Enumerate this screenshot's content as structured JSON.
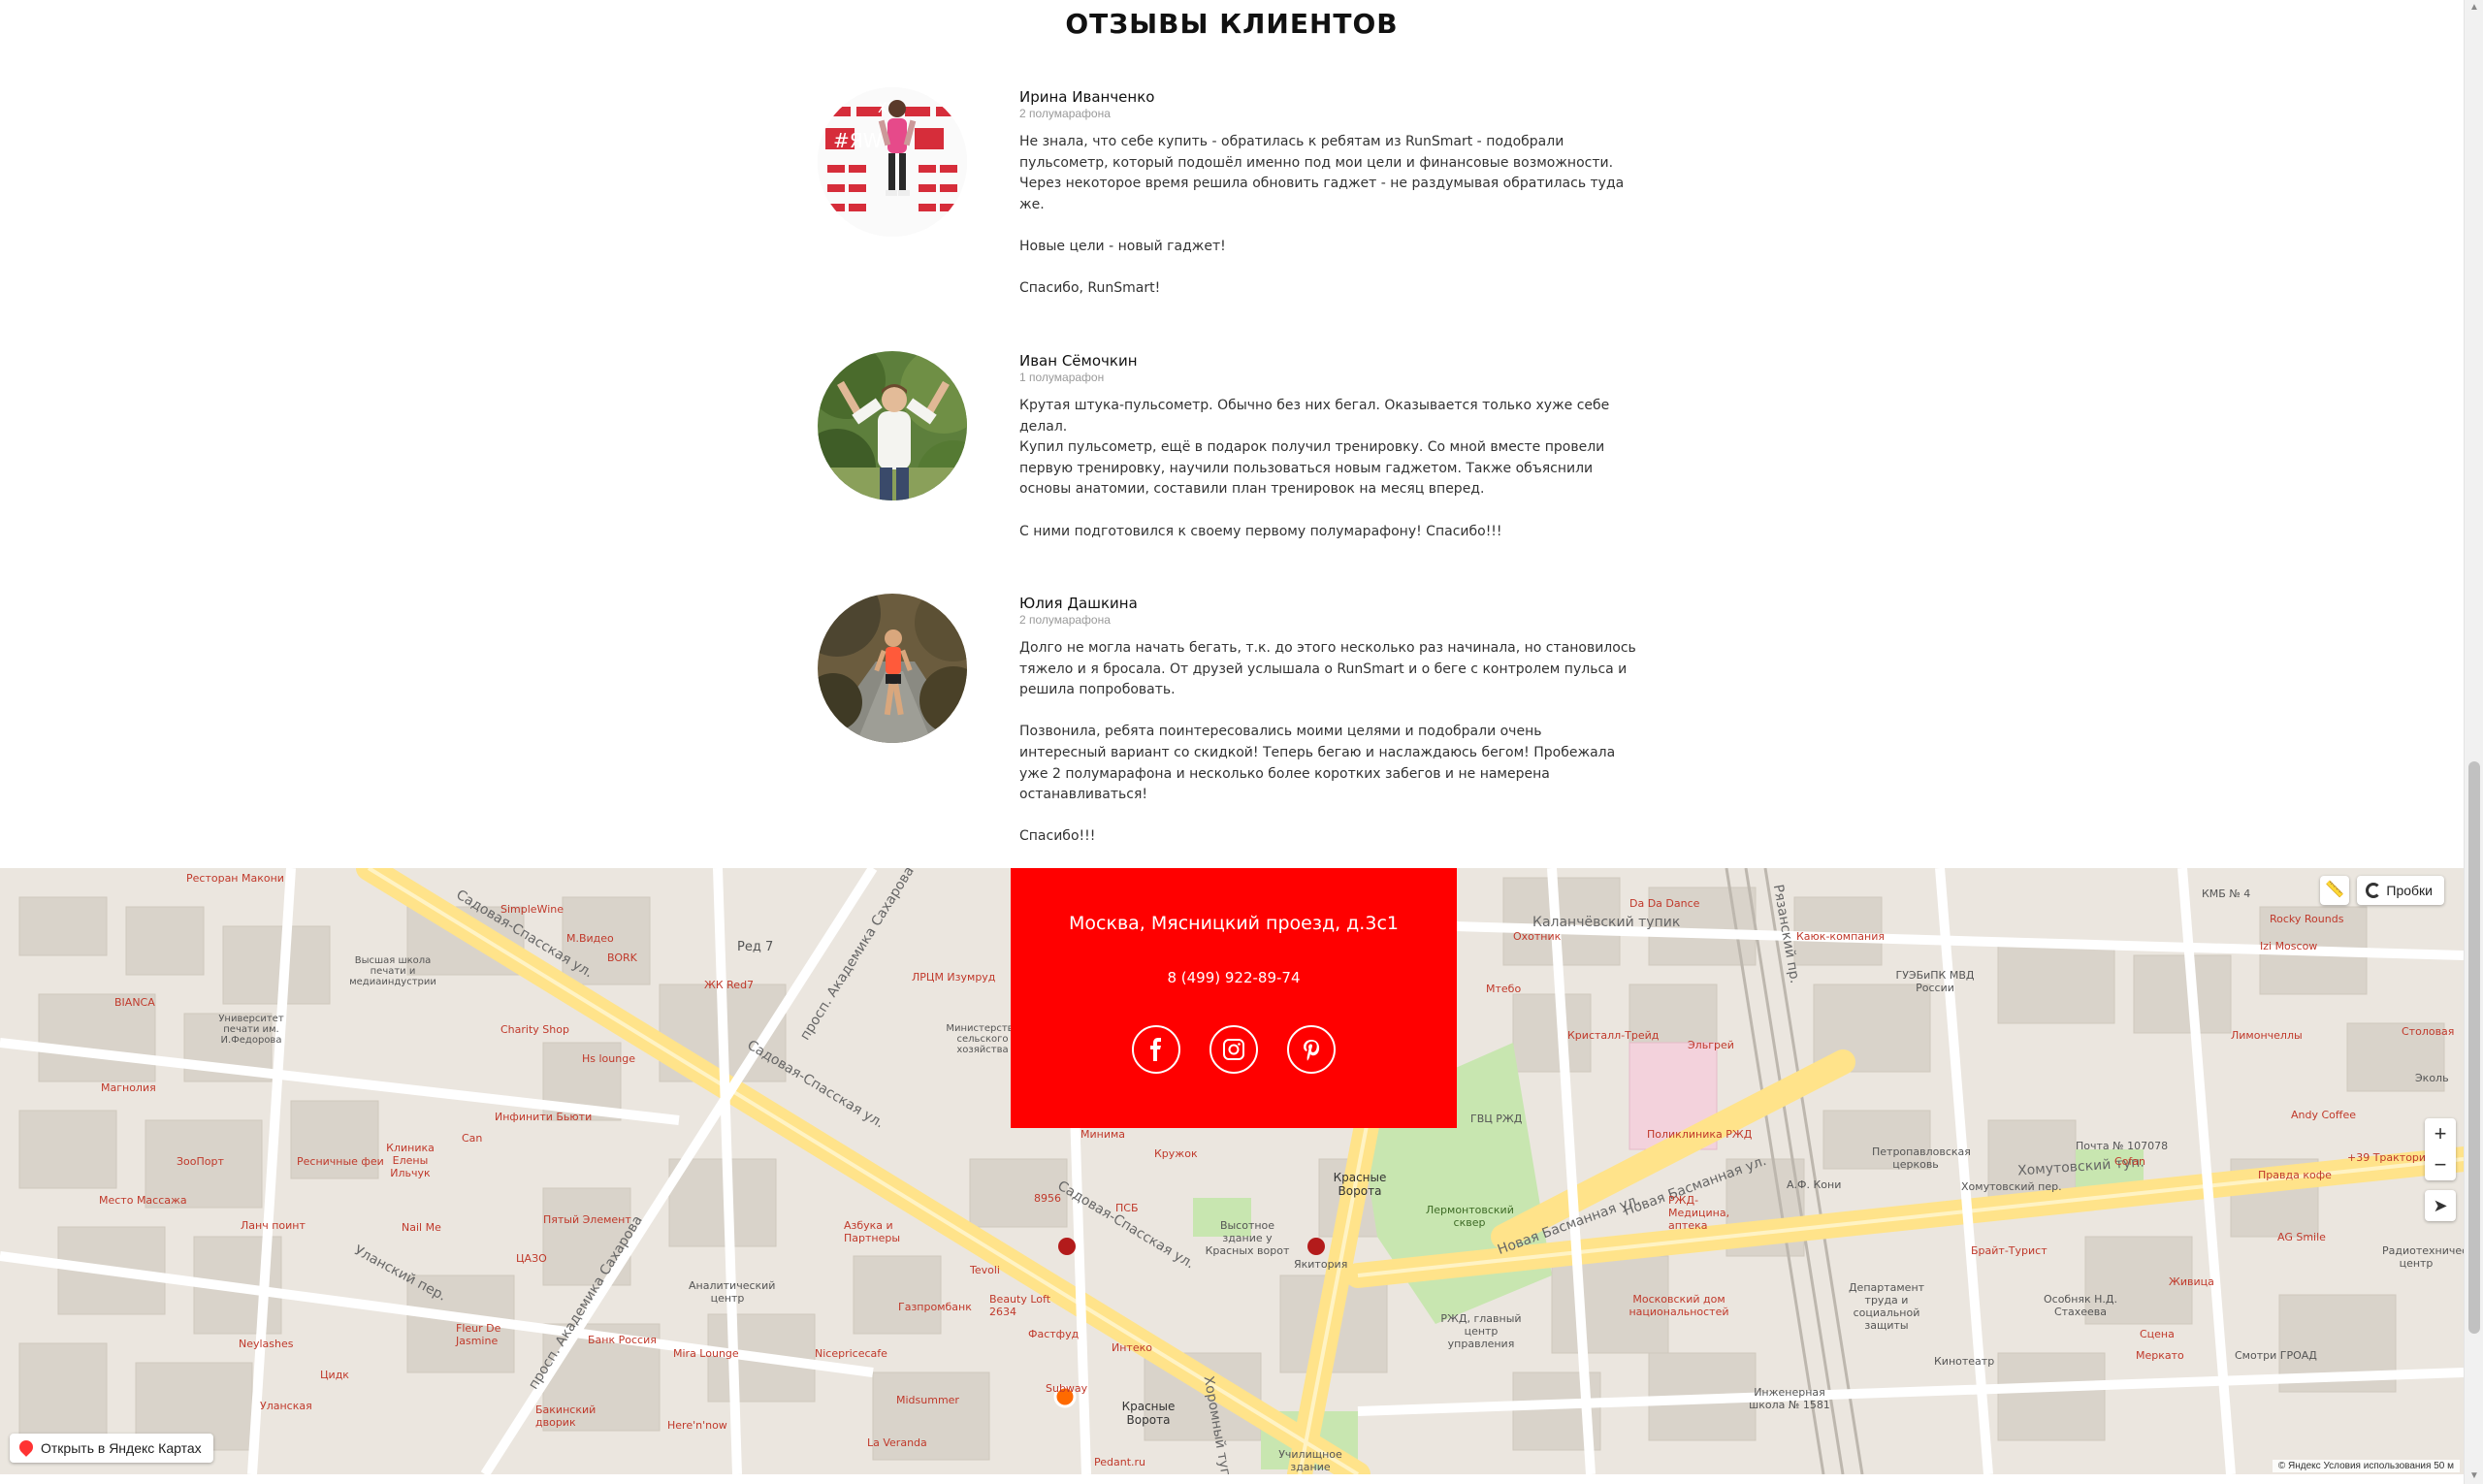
{
  "reviews": {
    "title": "ОТЗЫВЫ КЛИЕНТОВ",
    "items": [
      {
        "name": "Ирина Иванченко",
        "meta": "2 полумарафона",
        "text": "Не знала, что себе купить - обратилась к ребятам из RunSmart - подобрали\nпульсометр, который подошёл именно под мои цели и финансовые возможности.\nЧерез некоторое время решила обновить гаджет - не раздумывая обратилась туда\nже.\n\nНовые цели - новый гаджет!\n\nСпасибо, RunSmart!"
      },
      {
        "name": "Иван Сёмочкин",
        "meta": "1 полумарафон",
        "text": "Крутая штука-пульсометр. Обычно без них бегал. Оказывается только хуже себе\nделал.\nКупил пульсометр, ещё в подарок получил тренировку. Со мной вместе провели\nпервую тренировку, научили пользоваться новым гаджетом. Также объяснили\nосновы анатомии, составили план тренировок на месяц вперед.\n\nС ними подготовился к своему первому полумарафону! Спасибо!!!"
      },
      {
        "name": "Юлия Дашкина",
        "meta": "2 полумарафона",
        "text": "Долго не могла начать бегать, т.к. до этого несколько раз начинала, но становилось\nтяжело и я бросала. От друзей услышала о RunSmart и о беге с контролем пульса и\nрешила попробовать.\n\nПозвонила, ребята поинтересовались моими целями и подобрали очень\nинтересный вариант со скидкой! Теперь бегаю и наслаждаюсь бегом! Пробежала\nуже 2 полумарафона и несколько более коротких забегов и не намерена\nостанавливаться!\n\nСпасибо!!!"
      }
    ]
  },
  "contact": {
    "address": "Москва, Мясницкий проезд, д.3с1",
    "phone": "8 (499) 922-89-74",
    "socials": [
      "facebook-icon",
      "instagram-icon",
      "pinterest-icon"
    ]
  },
  "map": {
    "traffic_label": "Пробки",
    "open_label": "Открыть в Яндекс Картах",
    "copyright": "© Яндекс   Условия использования      50 м",
    "zoom_in": "+",
    "zoom_out": "−",
    "streets": [
      "Садовая-Спасская ул.",
      "Садовая-Спасская ул.",
      "Садовая-Спасская ул.",
      "просп. Академика Сахарова",
      "просп. Академика Сахарова",
      "Новая Басманная ул.",
      "Новая Басманная ул.",
      "Каланчёвский тупик",
      "Рязанский пр.",
      "Хомутовский туп.",
      "Уланский пер.",
      "Хоромный туп."
    ],
    "metro": [
      "Красные Ворота",
      "Красные Ворота"
    ],
    "pois": [
      "Ресторан Макони",
      "SimpleWine",
      "М.Видео",
      "BORK",
      "ЖК Red7",
      "Ред 7",
      "ЛРЦМ Изумруд",
      "Высшая школа печати и медиаиндустрии",
      "Университет печати им. И.Федорова",
      "Магнолия",
      "Charity Shop",
      "Hs lounge",
      "BIANCA",
      "Министерство сельского хозяйства",
      "Инфинити Бьюти",
      "Ресничные феи",
      "Клиника Елены Ильчук",
      "Can",
      "ЗооПорт",
      "Место Массажа",
      "Ланч поинт",
      "Nail Me",
      "Пятый Элемент",
      "ЦАЗО",
      "Азбука и Партнеры",
      "Аналитический центр",
      "Банк Россия",
      "Fleur De Jasmine",
      "Neylashes",
      "Цидк",
      "Уланская",
      "Mira Lounge",
      "Nicepricecafe",
      "Tevoli",
      "Beauty Loft 2634",
      "Газпромбанк",
      "Интеко",
      "Фастфуд",
      "Subway",
      "Midsummer",
      "Бакинский дворик",
      "Here'n'now",
      "La Veranda",
      "Pedant.ru",
      "Училищное здание",
      "Высотное здание у Красных ворот",
      "Якитория",
      "ПСБ",
      "Кружок",
      "Минима",
      "8956",
      "ГВЦ РЖД",
      "Лермонтовский сквер",
      "Кристалл-Трейд",
      "Эльгрей",
      "Поликлиника РЖД",
      "РЖД-Медицина, аптека",
      "РЖД, главный центр управления",
      "Московский дом национальностей",
      "Охотник",
      "Мтебо",
      "Da Da Dance",
      "Каюк-компания",
      "ГУЭБиПК МВД России",
      "Петропавловская церковь",
      "А.Ф. Кони",
      "Почта № 107078",
      "Хомутовский пер.",
      "Cofan",
      "Правда кофе",
      "+39 Трактория",
      "Andy Coffee",
      "Rocky Rounds",
      "Izi Moscow",
      "Столовая",
      "Лимончеллы",
      "AG Smile",
      "Брайт-Турист",
      "Особняк Н.Д. Стахеева",
      "Сцена",
      "Живица",
      "Меркато",
      "Департамент труда и социальной защиты",
      "Кинотеатр",
      "Инженерная школа № 1581",
      "КМБ № 4",
      "Смотри ГРОАД",
      "Радиотехнический центр",
      "Эколь"
    ]
  }
}
